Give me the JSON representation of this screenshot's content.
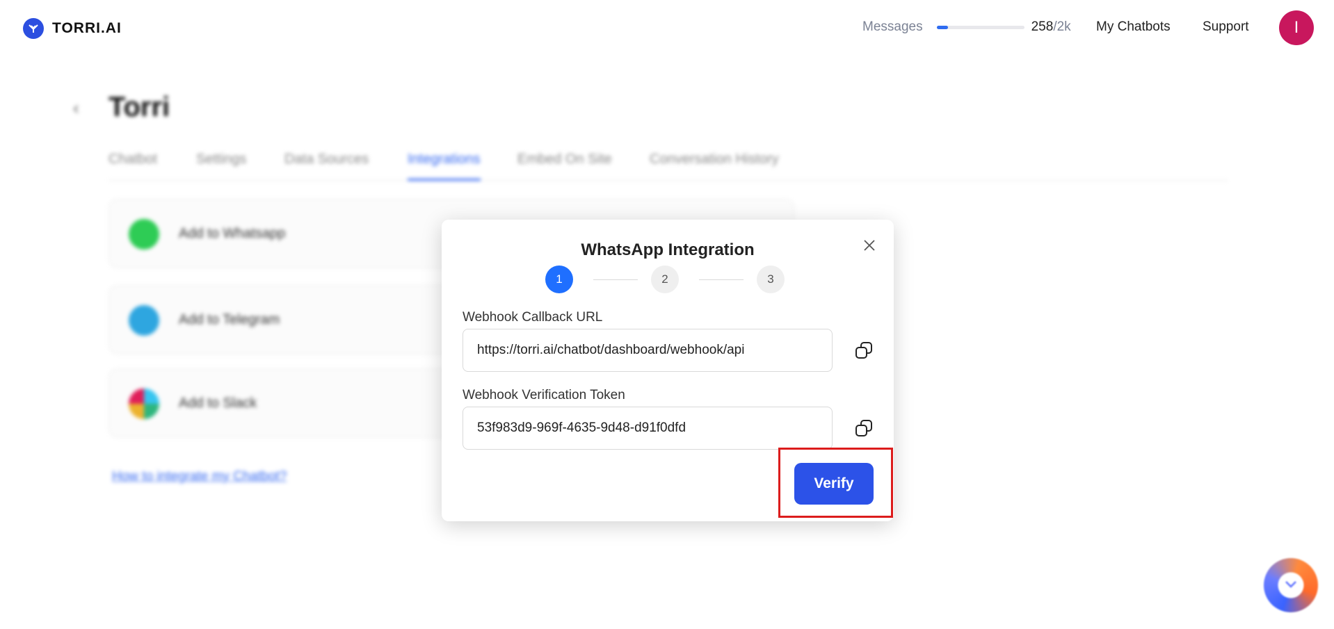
{
  "brand": {
    "name": "TORRI.AI"
  },
  "topbar": {
    "messages_label": "Messages",
    "messages_used": "258",
    "messages_total": "/2k",
    "messages_fraction": 0.129,
    "my_chatbots": "My Chatbots",
    "support": "Support",
    "avatar_initial": "I"
  },
  "background": {
    "title": "Torri",
    "tabs": [
      "Chatbot",
      "Settings",
      "Data Sources",
      "Integrations",
      "Embed On Site",
      "Conversation History"
    ],
    "active_tab": "Integrations",
    "integrations": [
      "Add to Whatsapp",
      "Add to Telegram",
      "Add to Slack"
    ],
    "help_link": "How to integrate my Chatbot?"
  },
  "modal": {
    "title": "WhatsApp Integration",
    "steps": [
      "1",
      "2",
      "3"
    ],
    "active_step": 1,
    "callback_label": "Webhook Callback URL",
    "callback_value": "https://torri.ai/chatbot/dashboard/webhook/api",
    "token_label": "Webhook Verification Token",
    "token_value": "53f983d9-969f-4635-9d48-d91f0dfd",
    "verify_label": "Verify"
  },
  "colors": {
    "primary": "#2c52e8",
    "step_active": "#1f6fff",
    "highlight": "#dc1c1c",
    "avatar": "#c8175d"
  }
}
